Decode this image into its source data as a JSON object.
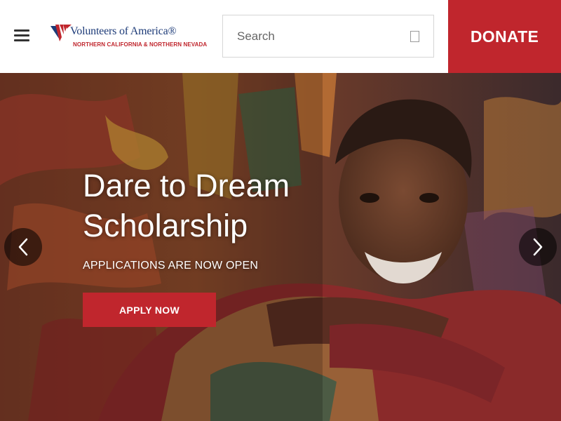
{
  "header": {
    "logo": {
      "name": "Volunteers of America®",
      "subtitle": "NORTHERN CALIFORNIA & NORTHERN NEVADA",
      "icon": "voa-flag-logo"
    },
    "menu_icon": "hamburger-menu-icon",
    "search": {
      "placeholder": "Search",
      "value": "",
      "icon": "search-icon"
    },
    "donate_label": "DONATE"
  },
  "hero": {
    "title": "Dare to Dream Scholarship",
    "subtitle": "APPLICATIONS ARE NOW OPEN",
    "cta_label": "APPLY NOW",
    "prev_icon": "chevron-left-icon",
    "next_icon": "chevron-right-icon"
  },
  "colors": {
    "brand_red": "#c0262d",
    "brand_blue": "#1d3b78",
    "header_bg": "#ffffff"
  }
}
